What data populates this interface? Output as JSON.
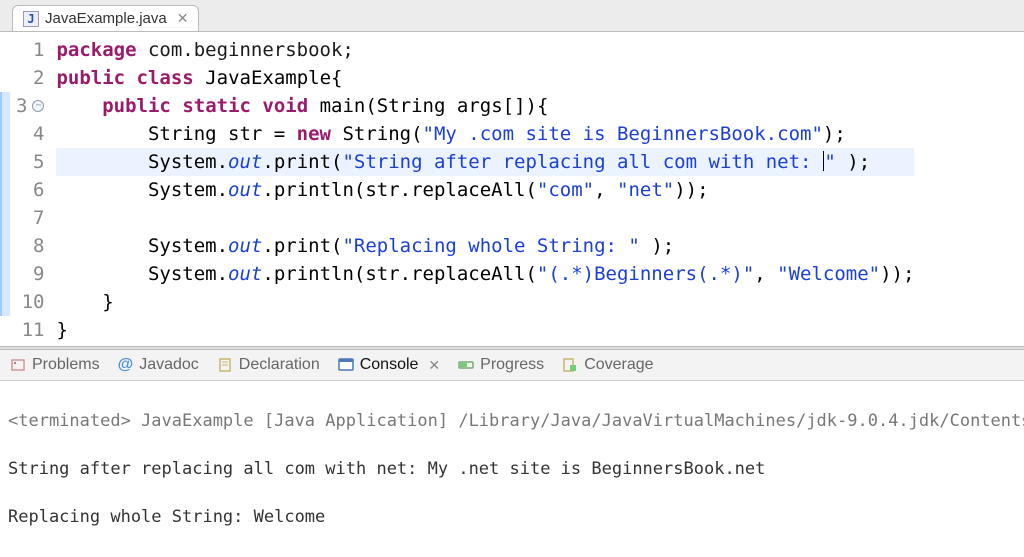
{
  "tab": {
    "filename": "JavaExample.java"
  },
  "code": {
    "lines": [
      {
        "n": 1
      },
      {
        "n": 2
      },
      {
        "n": 3,
        "fold": true
      },
      {
        "n": 4
      },
      {
        "n": 5,
        "active": true
      },
      {
        "n": 6
      },
      {
        "n": 7
      },
      {
        "n": 8
      },
      {
        "n": 9
      },
      {
        "n": 10
      },
      {
        "n": 11
      }
    ],
    "kw_package": "package",
    "pkg_name": " com.beginnersbook;",
    "kw_public": "public",
    "kw_class": "class",
    "cls_name": " JavaExample{",
    "kw_static": "static",
    "kw_void": "void",
    "main_sig": " main(String args[]){",
    "l4_a": "        String str = ",
    "kw_new": "new",
    "l4_b": " String(",
    "str1": "\"My .com site is BeginnersBook.com\"",
    "l4_c": ");",
    "l5_a": "        System.",
    "out": "out",
    "l5_b": ".print(",
    "str2": "\"String after replacing all com with net: ",
    "str2b": "\"",
    "l5_c": " );",
    "l6_a": "        System.",
    "l6_b": ".println(str.replaceAll(",
    "str3": "\"com\"",
    "l6_c": ", ",
    "str4": "\"net\"",
    "l6_d": "));",
    "l8_a": "        System.",
    "l8_b": ".print(",
    "str5": "\"Replacing whole String: \"",
    "l8_c": " );",
    "l9_a": "        System.",
    "l9_b": ".println(str.replaceAll(",
    "str6": "\"(.*)Beginners(.*)\"",
    "l9_c": ", ",
    "str7": "\"Welcome\"",
    "l9_d": "));",
    "l10": "    }",
    "l11": "}"
  },
  "bottom_tabs": {
    "problems": "Problems",
    "javadoc": "Javadoc",
    "declaration": "Declaration",
    "console": "Console",
    "progress": "Progress",
    "coverage": "Coverage"
  },
  "console": {
    "header": "<terminated> JavaExample [Java Application] /Library/Java/JavaVirtualMachines/jdk-9.0.4.jdk/Contents",
    "line1": "String after replacing all com with net: My .net site is BeginnersBook.net",
    "line2": "Replacing whole String: Welcome"
  }
}
